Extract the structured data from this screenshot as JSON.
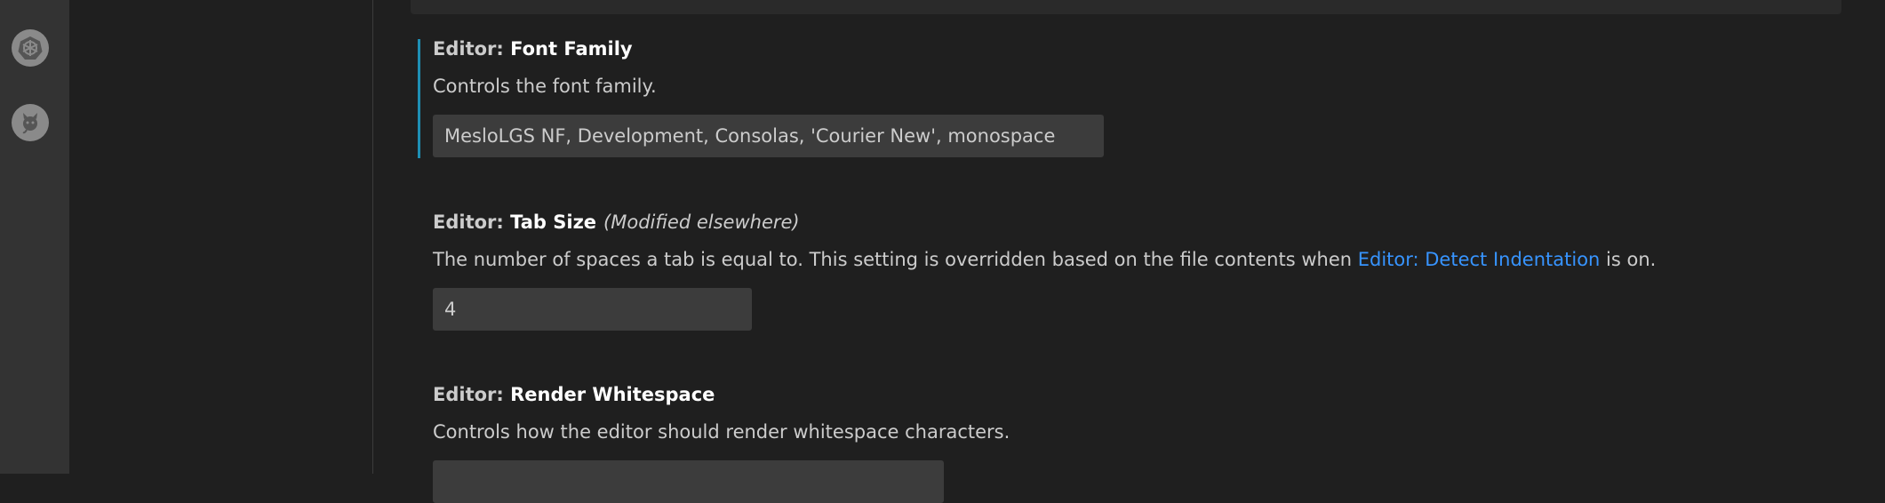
{
  "activity_bar": {
    "icons": [
      {
        "name": "kubernetes-icon"
      },
      {
        "name": "github-octocat-icon"
      }
    ]
  },
  "settings": [
    {
      "category": "Editor: ",
      "name": "Font Family",
      "modified": "",
      "description": "Controls the font family.",
      "value": "MesloLGS NF, Development, Consolas, 'Courier New', monospace"
    },
    {
      "category": "Editor: ",
      "name": "Tab Size",
      "modified": "(Modified elsewhere)",
      "description_before": "The number of spaces a tab is equal to. This setting is overridden based on the file contents when ",
      "description_link": "Editor: Detect Indentation",
      "description_after": " is on.",
      "value": "4"
    },
    {
      "category": "Editor: ",
      "name": "Render Whitespace",
      "modified": "",
      "description": "Controls how the editor should render whitespace characters.",
      "value": ""
    }
  ],
  "colors": {
    "background": "#1f1f1f",
    "activity_bar": "#333333",
    "focus_indicator": "#1e8fb4",
    "link": "#3794ff",
    "input_background": "#3c3c3c"
  }
}
